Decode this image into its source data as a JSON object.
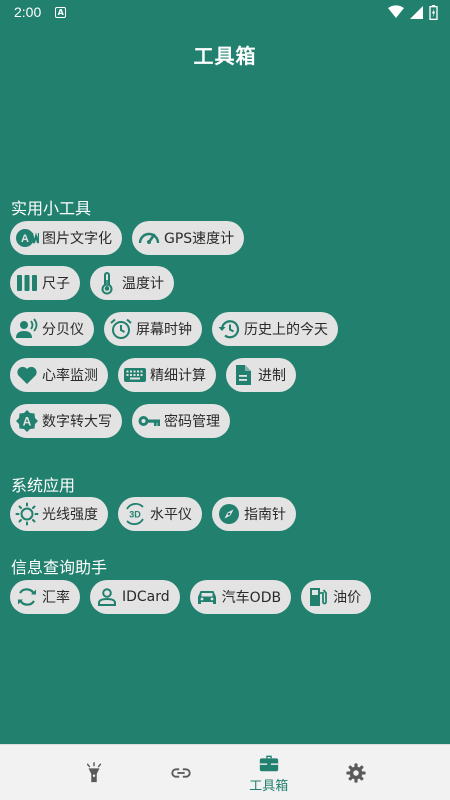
{
  "status_bar": {
    "time": "2:00"
  },
  "app": {
    "title": "工具箱"
  },
  "sections": [
    {
      "title": "实用小工具",
      "rows": [
        [
          {
            "label": "图片文字化",
            "icon": "text-recognition-icon"
          },
          {
            "label": "GPS速度计",
            "icon": "speedometer-icon"
          }
        ],
        [
          {
            "label": "尺子",
            "icon": "ruler-icon"
          },
          {
            "label": "温度计",
            "icon": "thermometer-icon"
          }
        ],
        [
          {
            "label": "分贝仪",
            "icon": "voice-icon"
          },
          {
            "label": "屏幕时钟",
            "icon": "alarm-clock-icon"
          },
          {
            "label": "历史上的今天",
            "icon": "history-icon"
          }
        ],
        [
          {
            "label": "心率监测",
            "icon": "heart-icon"
          },
          {
            "label": "精细计算",
            "icon": "keyboard-icon"
          },
          {
            "label": "进制",
            "icon": "document-icon"
          }
        ],
        [
          {
            "label": "数字转大写",
            "icon": "badge-a-icon"
          },
          {
            "label": "密码管理",
            "icon": "key-icon"
          }
        ]
      ]
    },
    {
      "title": "系统应用",
      "rows": [
        [
          {
            "label": "光线强度",
            "icon": "brightness-icon"
          },
          {
            "label": "水平仪",
            "icon": "3d-rotation-icon"
          },
          {
            "label": "指南针",
            "icon": "compass-icon"
          }
        ]
      ]
    },
    {
      "title": "信息查询助手",
      "rows": [
        [
          {
            "label": "汇率",
            "icon": "refresh-icon"
          },
          {
            "label": "IDCard",
            "icon": "person-icon"
          },
          {
            "label": "汽车ODB",
            "icon": "car-icon"
          },
          {
            "label": "油价",
            "icon": "gas-station-icon"
          }
        ]
      ]
    }
  ],
  "bottom_nav": [
    {
      "label": "",
      "icon": "flashlight-icon",
      "active": false
    },
    {
      "label": "",
      "icon": "link-icon",
      "active": false
    },
    {
      "label": "工具箱",
      "icon": "toolbox-icon",
      "active": true
    },
    {
      "label": "",
      "icon": "settings-icon",
      "active": false
    }
  ]
}
